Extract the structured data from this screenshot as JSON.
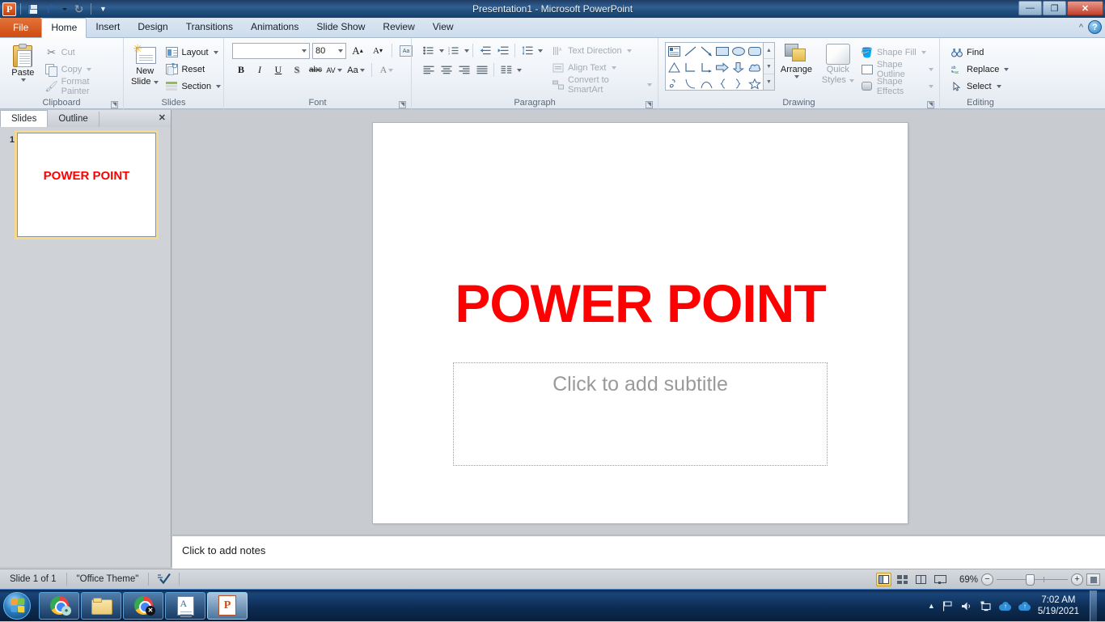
{
  "titlebar": {
    "title": "Presentation1  -  Microsoft PowerPoint",
    "qat": {
      "logo": "P",
      "save": "save-icon",
      "undo": "undo-icon",
      "redo": "redo-icon",
      "customize": "customize-qat-icon"
    },
    "window": {
      "minimize": "—",
      "restore": "❐",
      "close": "✕"
    }
  },
  "ribbon": {
    "tabs": [
      {
        "label": "File",
        "active": false,
        "kind": "file"
      },
      {
        "label": "Home",
        "active": true
      },
      {
        "label": "Insert",
        "active": false
      },
      {
        "label": "Design",
        "active": false
      },
      {
        "label": "Transitions",
        "active": false
      },
      {
        "label": "Animations",
        "active": false
      },
      {
        "label": "Slide Show",
        "active": false
      },
      {
        "label": "Review",
        "active": false
      },
      {
        "label": "View",
        "active": false
      }
    ],
    "collapse": "^",
    "help": "?",
    "groups": {
      "clipboard": {
        "label": "Clipboard",
        "paste": "Paste",
        "cut": "Cut",
        "copy": "Copy",
        "format_painter": "Format Painter"
      },
      "slides": {
        "label": "Slides",
        "new_slide_line1": "New",
        "new_slide_line2": "Slide",
        "layout": "Layout",
        "reset": "Reset",
        "section": "Section"
      },
      "font": {
        "label": "Font",
        "font_name": "",
        "font_name_placeholder": "",
        "font_size": "80",
        "grow": "A",
        "shrink": "A",
        "clear_formatting": "clear-formatting-icon",
        "bold": "B",
        "italic": "I",
        "underline": "U",
        "shadow": "S",
        "strikethrough": "abc",
        "spacing": "AV",
        "change_case": "Aa",
        "font_color": "A"
      },
      "paragraph": {
        "label": "Paragraph",
        "text_direction": "Text Direction",
        "align_text": "Align Text",
        "convert_smartart": "Convert to SmartArt"
      },
      "drawing": {
        "label": "Drawing",
        "arrange": "Arrange",
        "quick_styles_line1": "Quick",
        "quick_styles_line2": "Styles",
        "shape_fill": "Shape Fill",
        "shape_outline": "Shape Outline",
        "shape_effects": "Shape Effects"
      },
      "editing": {
        "label": "Editing",
        "find": "Find",
        "replace": "Replace",
        "select": "Select"
      }
    }
  },
  "left_pane": {
    "tabs": [
      {
        "label": "Slides",
        "active": true
      },
      {
        "label": "Outline",
        "active": false
      }
    ],
    "close": "✕",
    "slides": [
      {
        "number": "1",
        "title": "POWER POINT"
      }
    ]
  },
  "slide": {
    "title": "POWER POINT",
    "title_color": "#ff0000",
    "subtitle_placeholder": "Click to add subtitle"
  },
  "notes": {
    "placeholder": "Click to add notes"
  },
  "statusbar": {
    "slide_count": "Slide 1 of 1",
    "theme": "\"Office Theme\"",
    "spellcheck": "spellcheck-icon",
    "views": [
      {
        "name": "normal-view",
        "active": true
      },
      {
        "name": "slide-sorter-view",
        "active": false
      },
      {
        "name": "reading-view",
        "active": false
      },
      {
        "name": "slide-show-view",
        "active": false
      }
    ],
    "zoom": "69%",
    "zoom_out": "−",
    "zoom_in": "+",
    "fit_window": "fit-slide-to-window-icon"
  },
  "taskbar": {
    "start": "start-orb",
    "items": [
      {
        "name": "chrome-profile",
        "icon": "chrome-icon",
        "badge": "person",
        "active": false
      },
      {
        "name": "file-explorer",
        "icon": "folder-icon",
        "badge": "",
        "active": false
      },
      {
        "name": "chrome-blocked",
        "icon": "chrome-icon",
        "badge": "x",
        "active": false
      },
      {
        "name": "document-app",
        "icon": "document-icon",
        "badge": "",
        "active": false
      },
      {
        "name": "powerpoint",
        "icon": "powerpoint-icon",
        "badge": "",
        "active": true,
        "letter": "P"
      }
    ],
    "tray": {
      "show_hidden": "▲",
      "action_center": "flag-icon",
      "volume": "speaker-icon",
      "network": "network-icon",
      "cloud1": "cloud-upload-icon",
      "cloud2": "cloud-upload-icon",
      "time": "7:02 AM",
      "date": "5/19/2021"
    }
  }
}
